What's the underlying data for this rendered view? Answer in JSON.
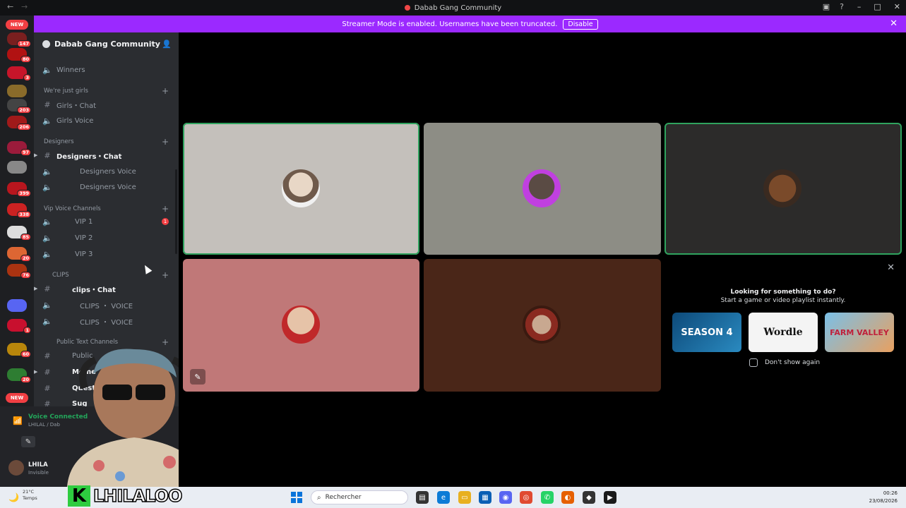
{
  "window": {
    "title": "Dabab Gang Community"
  },
  "streamer_bar": {
    "message": "Streamer Mode is enabled. Usernames have been truncated.",
    "disable_label": "Disable"
  },
  "server_rail": {
    "new_label_top": "NEW",
    "new_label_bottom": "NEW",
    "badges": [
      "147",
      "80",
      "3",
      "203",
      "206",
      "97",
      "399",
      "338",
      "85",
      "20",
      "76",
      "1",
      "60",
      "20"
    ]
  },
  "guild": {
    "name": "Dabab Gang Community"
  },
  "channels": {
    "winners": "Winners",
    "cat_girls": "We're just girls",
    "girls_chat": "Girls・Chat",
    "girls_voice": "Girls Voice",
    "cat_designers": "Designers",
    "designers_chat": "Designers・Chat",
    "designers_voice_1": "Designers Voice",
    "designers_voice_2": "Designers Voice",
    "cat_vip": "Vip Voice Channels",
    "vip1": "VIP 1",
    "vip1_mentions": "1",
    "vip2": "VIP 2",
    "vip3": "VIP 3",
    "cat_clips": "CLIPS",
    "clips_chat": "clips・Chat",
    "clips_voice_1": "CLIPS ・ VOICE",
    "clips_voice_2": "CLIPS ・ VOICE",
    "cat_public": "Public Text Channels",
    "public": "Public",
    "memes": "Meme",
    "questions": "Questio",
    "suggestions": "Sug"
  },
  "voice": {
    "status": "Voice Connected",
    "sub": "LHILAL / Dab"
  },
  "user": {
    "name": "LHILA",
    "status": "Invisible"
  },
  "activity_panel": {
    "heading": "Looking for something to do?",
    "sub": "Start a game or video playlist instantly.",
    "games": [
      "SEASON 4",
      "Wordle",
      "FARM VALLEY"
    ],
    "dont_show": "Don't show again"
  },
  "brand": {
    "letter": "K",
    "word": "LHILALOO"
  },
  "taskbar": {
    "temp": "21°C",
    "weather": "Temps",
    "search_placeholder": "Rechercher",
    "time": "00:26",
    "date": "23/08/2026"
  },
  "colors": {
    "accent": "#9b29ff",
    "speaking": "#2fa35e",
    "badge": "#f23f43"
  }
}
